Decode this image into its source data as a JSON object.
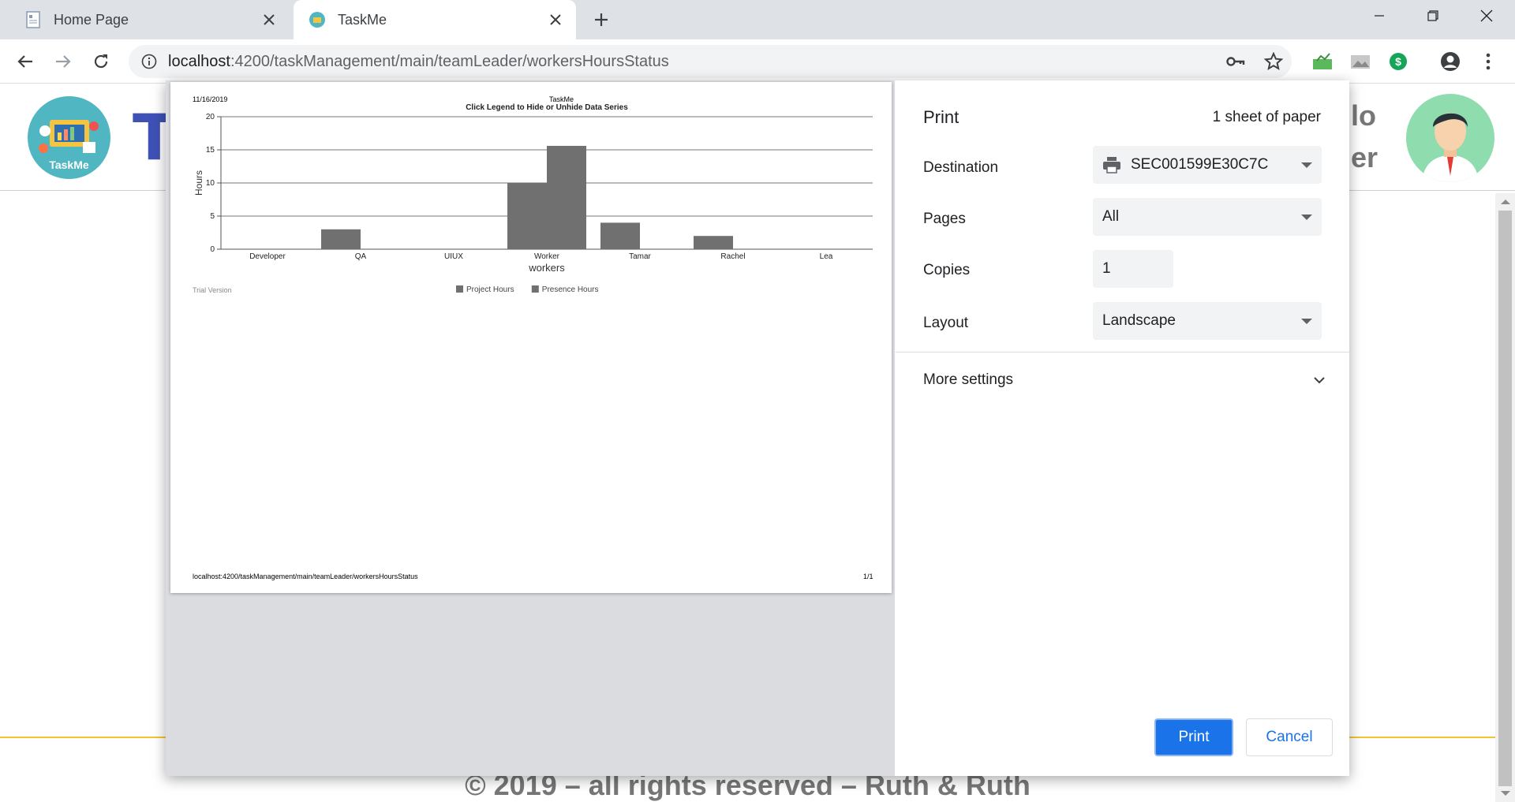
{
  "browser": {
    "tabs": [
      {
        "title": "Home Page",
        "icon": "document-icon",
        "active": false
      },
      {
        "title": "TaskMe",
        "icon": "taskme-favicon",
        "active": true
      }
    ],
    "url_host": "localhost",
    "url_path": ":4200/taskManagement/main/teamLeader/workersHoursStatus"
  },
  "page": {
    "logo_label": "TaskMe",
    "title_partial": "Ta",
    "greeting_partial": "lo",
    "role_partial": "er",
    "copyright": "© 2019 – all rights reserved – Ruth & Ruth",
    "footer_line_color": "#f4c430"
  },
  "print_dialog": {
    "title": "Print",
    "sheets": "1 sheet of paper",
    "destination_label": "Destination",
    "destination_value": "SEC001599E30C7C",
    "pages_label": "Pages",
    "pages_value": "All",
    "copies_label": "Copies",
    "copies_value": "1",
    "layout_label": "Layout",
    "layout_value": "Landscape",
    "more_settings_label": "More settings",
    "print_button": "Print",
    "cancel_button": "Cancel",
    "accent_color": "#1a73e8"
  },
  "preview": {
    "header_date": "11/16/2019",
    "header_title": "TaskMe",
    "footer_url": "localhost:4200/taskManagement/main/teamLeader/workersHoursStatus",
    "footer_page": "1/1",
    "trial_text": "Trial Version"
  },
  "chart_data": {
    "type": "bar",
    "title": "Click Legend to Hide or Unhide Data Series",
    "xlabel": "workers",
    "ylabel": "Hours",
    "ylim": [
      0,
      20
    ],
    "yticks": [
      0,
      5,
      10,
      15,
      20
    ],
    "grid": true,
    "legend_position": "bottom",
    "categories": [
      "Developer",
      "QA",
      "UIUX",
      "Worker",
      "Tamar",
      "Rachel",
      "Lea"
    ],
    "series": [
      {
        "name": "Project Hours",
        "color": "#707070",
        "values": [
          0,
          3,
          0,
          10,
          4,
          2,
          0
        ]
      },
      {
        "name": "Presence Hours",
        "color": "#707070",
        "values": [
          0,
          0,
          0,
          15.6,
          0,
          0,
          0
        ]
      }
    ]
  }
}
